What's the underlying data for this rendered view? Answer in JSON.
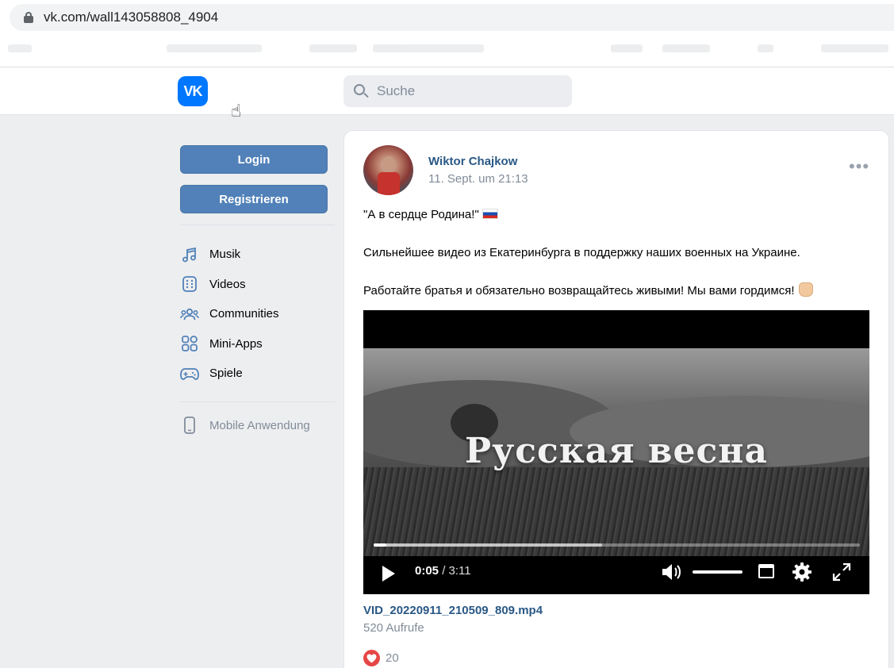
{
  "browser": {
    "url": "vk.com/wall143058808_4904"
  },
  "header": {
    "logo_text": "VK",
    "search_placeholder": "Suche"
  },
  "sidebar": {
    "login_label": "Login",
    "register_label": "Registrieren",
    "nav_items": [
      {
        "label": "Musik",
        "icon": "music-icon"
      },
      {
        "label": "Videos",
        "icon": "videos-icon"
      },
      {
        "label": "Communities",
        "icon": "communities-icon"
      },
      {
        "label": "Mini-Apps",
        "icon": "mini-apps-icon"
      },
      {
        "label": "Spiele",
        "icon": "gamepad-icon"
      }
    ],
    "mobile_label": "Mobile Anwendung"
  },
  "post": {
    "author": "Wiktor Chajkow",
    "date": "11. Sept. um 21:13",
    "more_label": "•••",
    "text_line1": "\"А в сердце Родина!\"",
    "text_line2": "Сильнейшее видео из Екатеринбурга в поддержку наших военных на Украине.",
    "text_line3": "Работайте братья и обязательно возвращайтесь живыми! Мы вами гордимся!",
    "video": {
      "overlay_title": "Русская весна",
      "current_time": "0:05",
      "duration": "3:11",
      "time_separator": " / ",
      "played_fraction": 0.026,
      "buffered_fraction": 0.47,
      "volume_fraction": 1.0
    },
    "video_filename": "VID_20220911_210509_809.mp4",
    "views": "520 Aufrufe",
    "likes_count": "20"
  },
  "colors": {
    "vk_blue": "#0077ff",
    "button_blue": "#5181b8",
    "link_blue": "#2a5885",
    "muted_gray": "#818c99",
    "like_red": "#e64646"
  }
}
